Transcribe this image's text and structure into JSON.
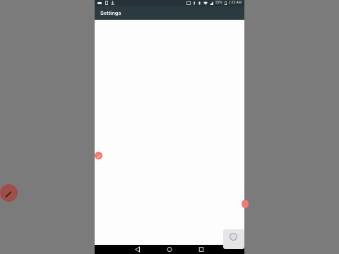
{
  "statusbar": {
    "battery": "15%",
    "time": "1:23 AM"
  },
  "appbar": {
    "title": "Settings"
  },
  "navbar": {
    "back_icon": "triangle-back-icon",
    "home_icon": "circle-home-icon",
    "recents_icon": "square-recents-icon"
  },
  "colors": {
    "statusbar_bg": "#263238",
    "appbar_bg": "#2a3a40",
    "floating_edit": "#f07a72",
    "backdrop": "#7b7b7b"
  }
}
